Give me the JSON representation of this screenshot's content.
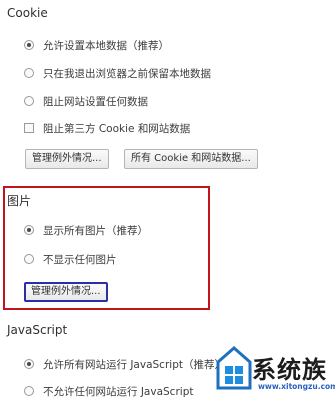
{
  "cookie": {
    "heading": "Cookie",
    "options": [
      {
        "label": "允许设置本地数据（推荐）",
        "checked": true
      },
      {
        "label": "只在我退出浏览器之前保留本地数据",
        "checked": false
      },
      {
        "label": "阻止网站设置任何数据",
        "checked": false
      }
    ],
    "checkbox_label": "阻止第三方 Cookie 和网站数据",
    "checkbox_checked": false,
    "manage_exceptions_button": "管理例外情况...",
    "all_cookies_button": "所有 Cookie 和网站数据..."
  },
  "images": {
    "heading": "图片",
    "options": [
      {
        "label": "显示所有图片（推荐）",
        "checked": true
      },
      {
        "label": "不显示任何图片",
        "checked": false
      }
    ],
    "manage_exceptions_button": "管理例外情况..."
  },
  "javascript": {
    "heading": "JavaScript",
    "options": [
      {
        "label": "允许所有网站运行 JavaScript（推荐）",
        "checked": true
      },
      {
        "label": "不允许任何网站运行 JavaScript",
        "checked": false
      }
    ]
  },
  "watermark": {
    "title": "系统族",
    "url": "www.xitongzu.com"
  },
  "colors": {
    "highlight_red": "#c0151b",
    "focus_blue": "#2a2fa8"
  }
}
